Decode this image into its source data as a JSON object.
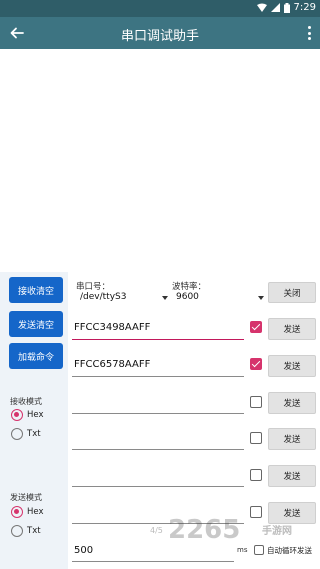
{
  "status_bar": {
    "time": "7:29"
  },
  "app_bar": {
    "title": "串口调试助手"
  },
  "left_panel": {
    "clear_receive_label": "接收清空",
    "clear_send_label": "发送清空",
    "load_command_label": "加载命令",
    "receive_mode": {
      "label": "接收模式",
      "options": [
        "Hex",
        "Txt"
      ],
      "selected": "Hex"
    },
    "send_mode": {
      "label": "发送模式",
      "options": [
        "Hex",
        "Txt"
      ],
      "selected": "Hex"
    }
  },
  "serial": {
    "port_label": "串口号：",
    "port_value": "/dev/ttyS3",
    "baud_label": "波特率：",
    "baud_value": "9600",
    "close_label": "关闭"
  },
  "command_rows": [
    {
      "value": "FFCC3498AAFF",
      "checked": true,
      "send_label": "发送"
    },
    {
      "value": "FFCC6578AAFF",
      "checked": true,
      "send_label": "发送"
    },
    {
      "value": "",
      "checked": false,
      "send_label": "发送"
    },
    {
      "value": "",
      "checked": false,
      "send_label": "发送"
    },
    {
      "value": "",
      "checked": false,
      "send_label": "发送"
    },
    {
      "value": "",
      "checked": false,
      "send_label": "发送"
    }
  ],
  "bottom": {
    "interval_value": "500",
    "ms_label": "ms",
    "auto_send_label": "自动循环发送",
    "page_indicator": "4/5"
  },
  "watermark": {
    "main": "2265",
    "sub": "手游网"
  },
  "colors": {
    "app_bar": "#3d7482",
    "status_bar": "#2f5d68",
    "primary_button": "#1566c9",
    "accent": "#d6336c"
  }
}
